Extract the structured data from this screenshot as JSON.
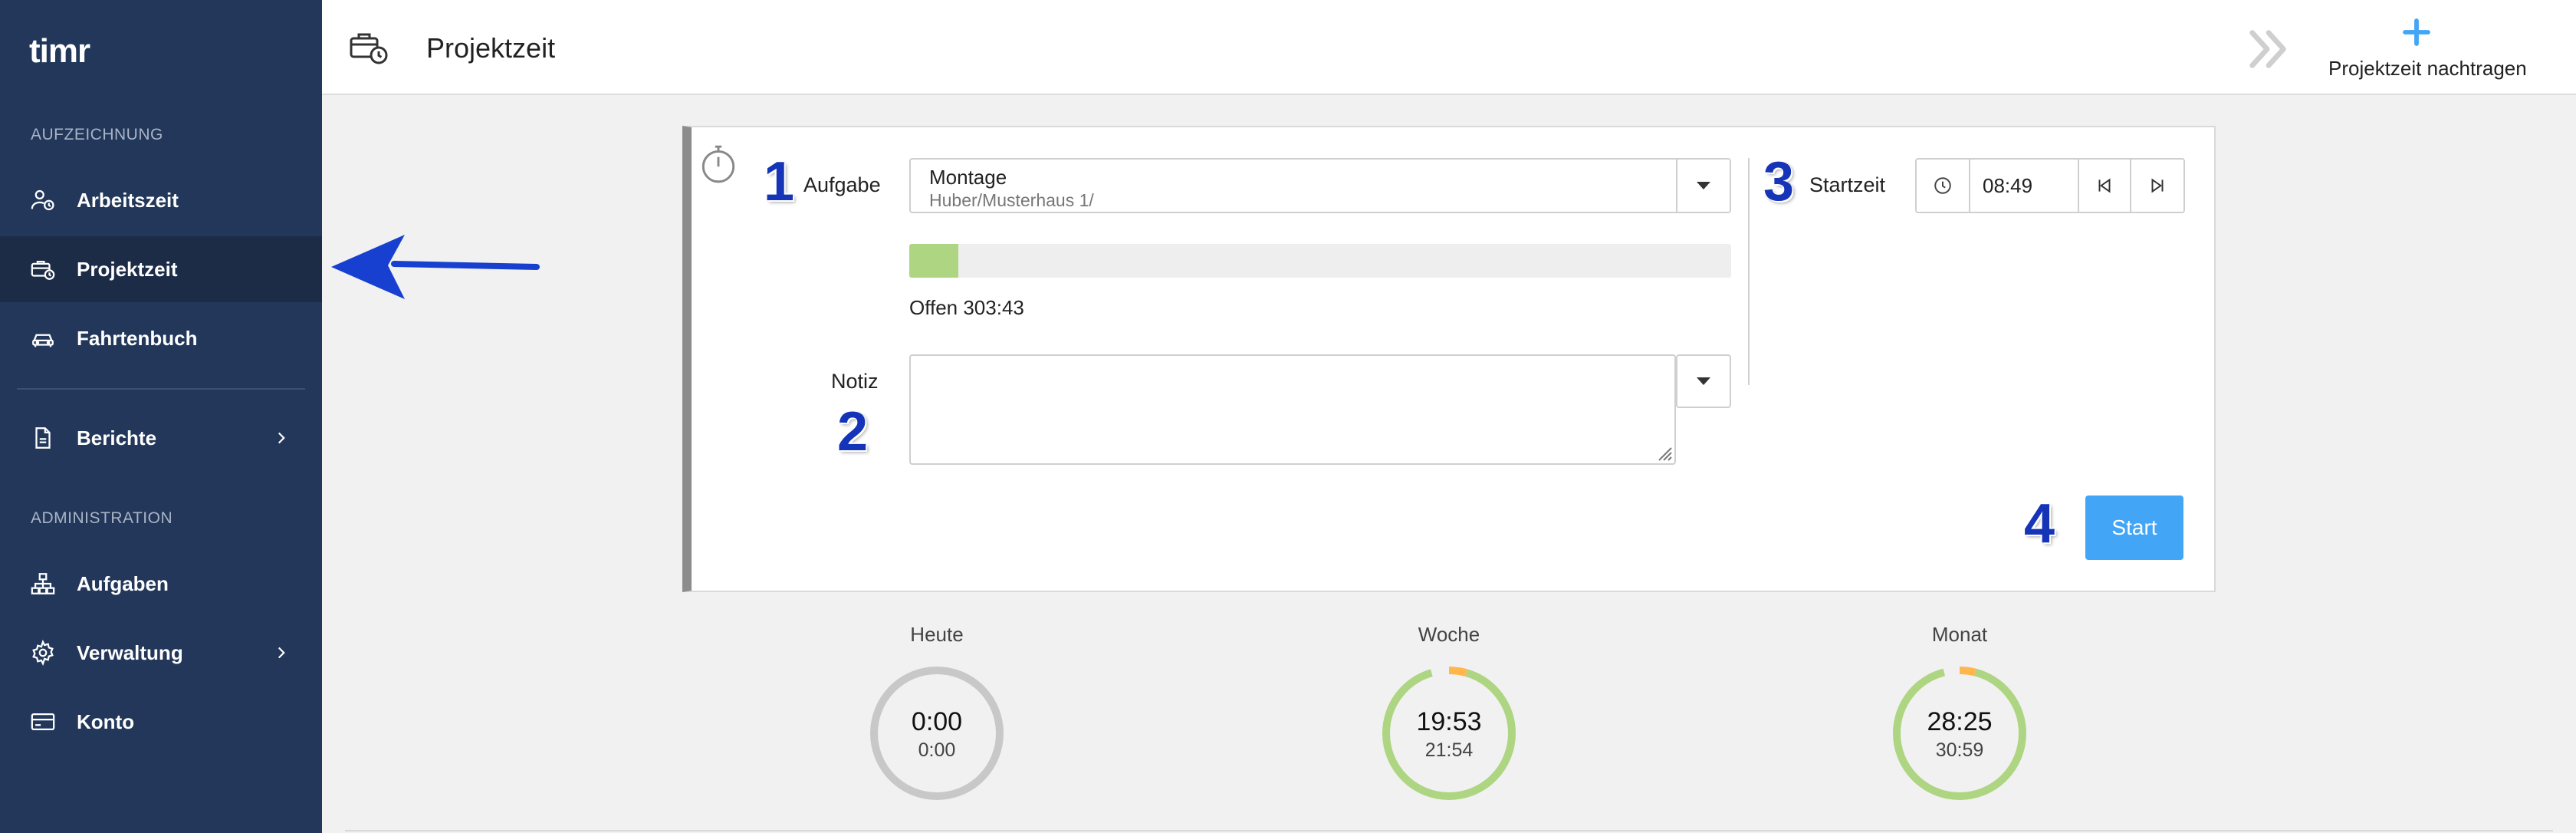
{
  "app": {
    "logo_text": "timr"
  },
  "sidebar": {
    "section_recording": "AUFZEICHNUNG",
    "section_admin": "ADMINISTRATION",
    "items": [
      {
        "label": "Arbeitszeit",
        "icon": "user-clock-icon"
      },
      {
        "label": "Projektzeit",
        "icon": "briefcase-clock-icon",
        "active": true
      },
      {
        "label": "Fahrtenbuch",
        "icon": "car-icon"
      },
      {
        "label": "Berichte",
        "icon": "document-icon",
        "has_chevron": true
      },
      {
        "label": "Aufgaben",
        "icon": "hierarchy-icon"
      },
      {
        "label": "Verwaltung",
        "icon": "gear-icon",
        "has_chevron": true
      },
      {
        "label": "Konto",
        "icon": "credit-card-icon"
      }
    ]
  },
  "header": {
    "title": "Projektzeit",
    "add_label": "Projektzeit nachtragen"
  },
  "form": {
    "task_label": "Aufgabe",
    "task_name": "Montage",
    "task_path": "Huber/Musterhaus 1/",
    "progress_fraction": 0.06,
    "offen_text": "Offen 303:43",
    "note_label": "Notiz",
    "note_value": "",
    "start_label": "Startzeit",
    "start_time": "08:49",
    "start_button": "Start"
  },
  "markers": [
    "1",
    "2",
    "3",
    "4"
  ],
  "stats": [
    {
      "label": "Heute",
      "main": "0:00",
      "sub": "0:00",
      "green_fraction": 0.0,
      "orange_fraction": 0.0
    },
    {
      "label": "Woche",
      "main": "19:53",
      "sub": "21:54",
      "green_fraction": 0.91,
      "orange_fraction": 0.09
    },
    {
      "label": "Monat",
      "main": "28:25",
      "sub": "30:59",
      "green_fraction": 0.92,
      "orange_fraction": 0.08
    }
  ],
  "colors": {
    "sidebar_bg": "#22375a",
    "sidebar_active": "#1c2c47",
    "accent": "#42a5f5",
    "progress": "#aed581",
    "ring_green": "#aed581",
    "ring_orange": "#ffb74d",
    "ring_gray": "#c8c8c8",
    "marker": "#1534b8",
    "arrow": "#1840d0"
  }
}
